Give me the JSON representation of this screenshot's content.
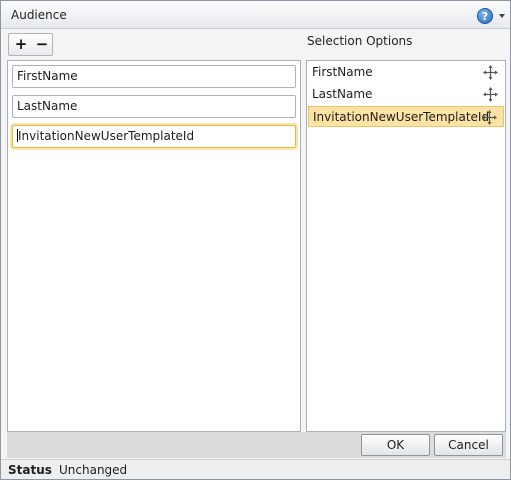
{
  "dialog": {
    "title": "Audience",
    "help_glyph": "?"
  },
  "toolbar": {
    "add_glyph": "+",
    "remove_glyph": "−"
  },
  "fields": [
    {
      "value": "FirstName"
    },
    {
      "value": "LastName"
    },
    {
      "value": "InvitationNewUserTemplateId",
      "focused": true
    }
  ],
  "selection": {
    "header": "Selection Options",
    "options": [
      {
        "label": "FirstName",
        "icon": "move-icon"
      },
      {
        "label": "LastName",
        "icon": "move-icon"
      },
      {
        "label": "InvitationNewUserTemplateId",
        "icon": "move-icon",
        "selected": true
      }
    ]
  },
  "buttons": {
    "ok_label": "OK",
    "cancel_label": "Cancel"
  },
  "status": {
    "label": "Status",
    "value": "Unchanged"
  },
  "colors": {
    "focus_border": "#e3b54a",
    "selected_bg": "#fde3a3",
    "help_blue": "#2a6bc0"
  }
}
